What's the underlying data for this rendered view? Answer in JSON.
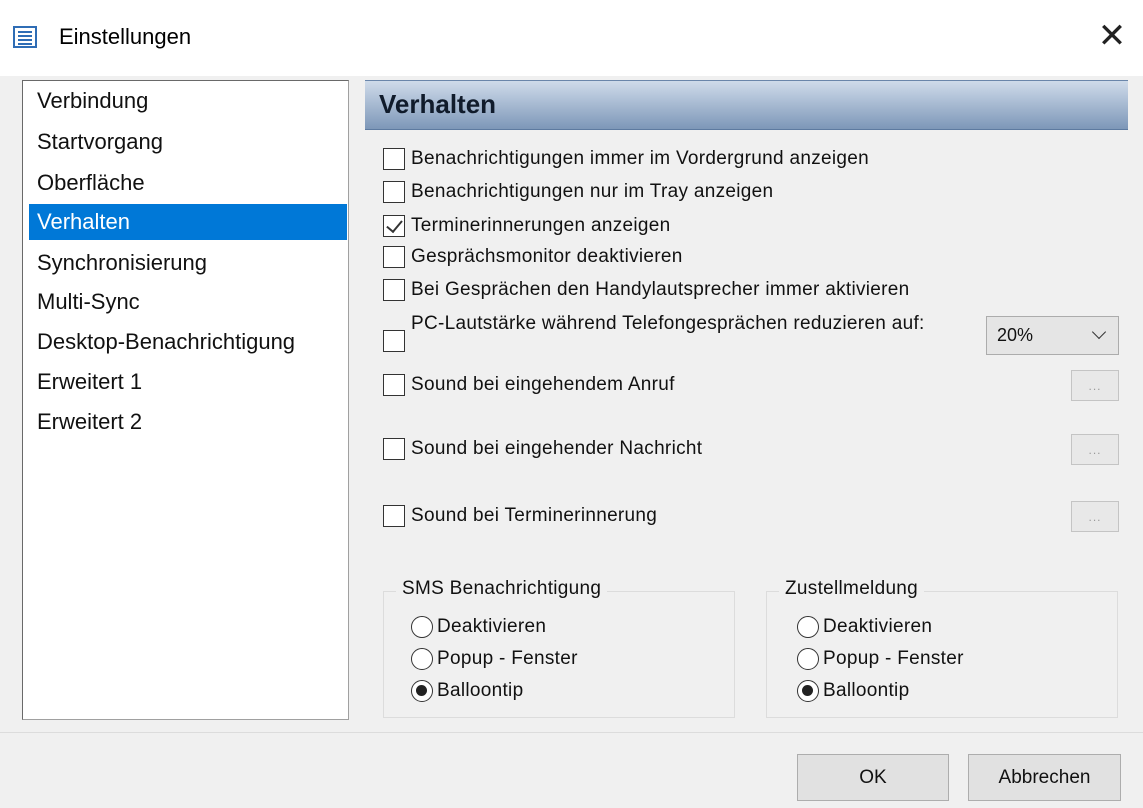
{
  "window": {
    "title": "Einstellungen",
    "close_glyph": "✕",
    "icon": "settings-list-icon"
  },
  "nav": {
    "selected": "Verhalten",
    "items": [
      "Verbindung",
      "Startvorgang",
      "Oberfläche",
      "Verhalten",
      "Synchronisierung",
      "Multi-Sync",
      "Desktop-Benachrichtigung",
      "Erweitert 1",
      "Erweitert 2"
    ]
  },
  "panel": {
    "title": "Verhalten",
    "options": [
      {
        "label": "Benachrichtigungen immer im Vordergrund anzeigen",
        "checked": false
      },
      {
        "label": "Benachrichtigungen nur im Tray anzeigen",
        "checked": false
      },
      {
        "label": "Terminerinnerungen anzeigen",
        "checked": true
      },
      {
        "label": "Gesprächsmonitor deaktivieren",
        "checked": false
      },
      {
        "label": "Bei Gesprächen den Handylautsprecher immer aktivieren",
        "checked": false
      }
    ],
    "volume": {
      "label": "PC-Lautstärke während Telefongesprächen reduzieren auf:",
      "checked": false,
      "value": "20%"
    },
    "sounds": [
      {
        "label": "Sound bei eingehendem Anruf",
        "checked": false,
        "button": "..."
      },
      {
        "label": "Sound bei eingehender Nachricht",
        "checked": false,
        "button": "..."
      },
      {
        "label": "Sound bei Terminerinnerung",
        "checked": false,
        "button": "..."
      }
    ],
    "sms_group": {
      "title": "SMS Benachrichtigung",
      "options": [
        "Deaktivieren",
        "Popup - Fenster",
        "Balloontip"
      ],
      "selected": "Balloontip"
    },
    "delivery_group": {
      "title": "Zustellmeldung",
      "options": [
        "Deaktivieren",
        "Popup - Fenster",
        "Balloontip"
      ],
      "selected": "Balloontip"
    }
  },
  "footer": {
    "ok_label": "OK",
    "cancel_label": "Abbrechen"
  },
  "colors": {
    "selection": "#0078d7",
    "header_top": "#cfdbea",
    "header_bottom": "#7d97b8"
  }
}
